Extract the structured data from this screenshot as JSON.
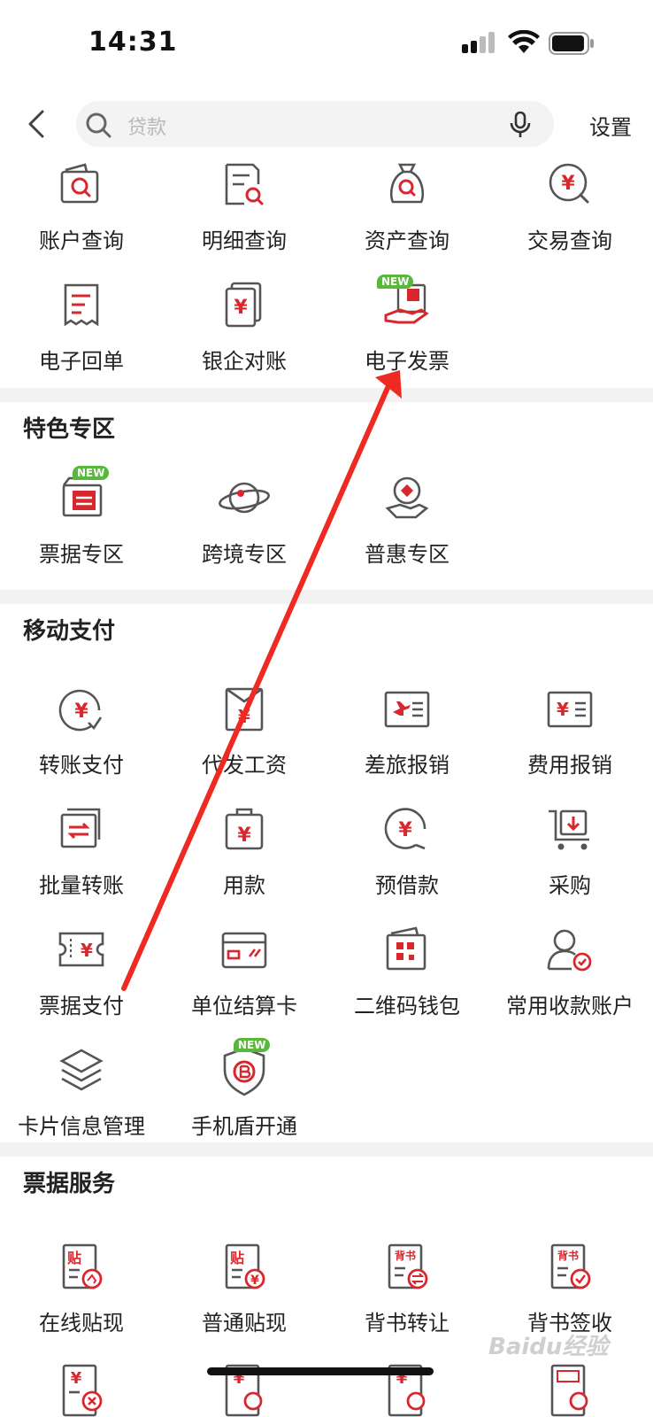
{
  "status_bar": {
    "time": "14:31"
  },
  "search": {
    "placeholder": "贷款",
    "settings_label": "设置"
  },
  "top_services": [
    {
      "label": "账户查询",
      "icon": "account-query-icon"
    },
    {
      "label": "明细查询",
      "icon": "detail-query-icon"
    },
    {
      "label": "资产查询",
      "icon": "asset-query-icon"
    },
    {
      "label": "交易查询",
      "icon": "transaction-query-icon"
    },
    {
      "label": "电子回单",
      "icon": "e-receipt-icon"
    },
    {
      "label": "银企对账",
      "icon": "bank-reconcile-icon"
    },
    {
      "label": "电子发票",
      "icon": "e-invoice-icon",
      "badge": "NEW"
    }
  ],
  "featured": {
    "title": "特色专区",
    "items": [
      {
        "label": "票据专区",
        "icon": "bill-zone-icon",
        "badge": "NEW"
      },
      {
        "label": "跨境专区",
        "icon": "cross-border-icon"
      },
      {
        "label": "普惠专区",
        "icon": "inclusive-finance-icon"
      }
    ]
  },
  "mobile_payment": {
    "title": "移动支付",
    "items": [
      {
        "label": "转账支付",
        "icon": "transfer-pay-icon"
      },
      {
        "label": "代发工资",
        "icon": "payroll-icon"
      },
      {
        "label": "差旅报销",
        "icon": "travel-expense-icon"
      },
      {
        "label": "费用报销",
        "icon": "expense-claim-icon"
      },
      {
        "label": "批量转账",
        "icon": "batch-transfer-icon"
      },
      {
        "label": "用款",
        "icon": "use-funds-icon"
      },
      {
        "label": "预借款",
        "icon": "advance-loan-icon"
      },
      {
        "label": "采购",
        "icon": "purchase-icon"
      },
      {
        "label": "票据支付",
        "icon": "bill-pay-icon"
      },
      {
        "label": "单位结算卡",
        "icon": "settlement-card-icon"
      },
      {
        "label": "二维码钱包",
        "icon": "qr-wallet-icon"
      },
      {
        "label": "常用收款账户",
        "icon": "payee-account-icon"
      },
      {
        "label": "卡片信息管理",
        "icon": "card-info-icon"
      },
      {
        "label": "手机盾开通",
        "icon": "mobile-shield-icon",
        "badge": "NEW"
      }
    ]
  },
  "bill_services": {
    "title": "票据服务",
    "items": [
      {
        "label": "在线贴现",
        "icon": "online-discount-icon",
        "tag": "贴"
      },
      {
        "label": "普通贴现",
        "icon": "regular-discount-icon",
        "tag": "贴"
      },
      {
        "label": "背书转让",
        "icon": "endorse-transfer-icon",
        "tag": "背书"
      },
      {
        "label": "背书签收",
        "icon": "endorse-sign-icon",
        "tag": "背书"
      }
    ]
  },
  "watermark": "Baidu经验",
  "colors": {
    "accent": "#d9272e",
    "icon_gray": "#555555",
    "divider": "#f2f2f2",
    "new_badge": "#58b83c"
  }
}
